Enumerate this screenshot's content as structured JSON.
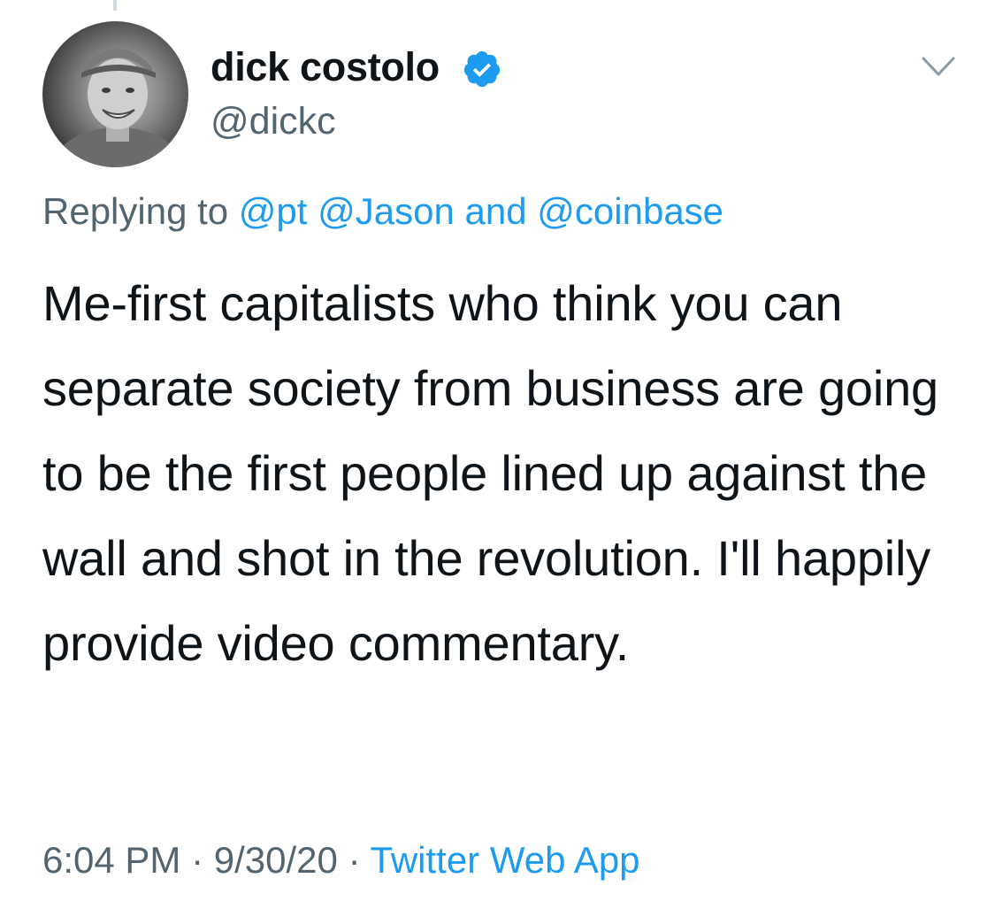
{
  "author": {
    "display_name": "dick costolo",
    "handle": "@dickc",
    "verified": true
  },
  "reply_context": {
    "prefix": "Replying to",
    "mentions": [
      "@pt",
      "@Jason"
    ],
    "conjunction": "and",
    "last_mention": "@coinbase"
  },
  "tweet_text": "Me-first capitalists who think you can separate society from business are going to be the first people lined up against the wall and shot in the revolution. I'll happily provide video commentary.",
  "meta": {
    "time": "6:04 PM",
    "separator": "·",
    "date": "9/30/20",
    "source": "Twitter Web App"
  },
  "colors": {
    "text": "#0f1419",
    "secondary": "#536471",
    "accent": "#1d9bf0"
  },
  "icons": {
    "verified": "verified-badge-icon",
    "menu": "chevron-down-icon"
  }
}
